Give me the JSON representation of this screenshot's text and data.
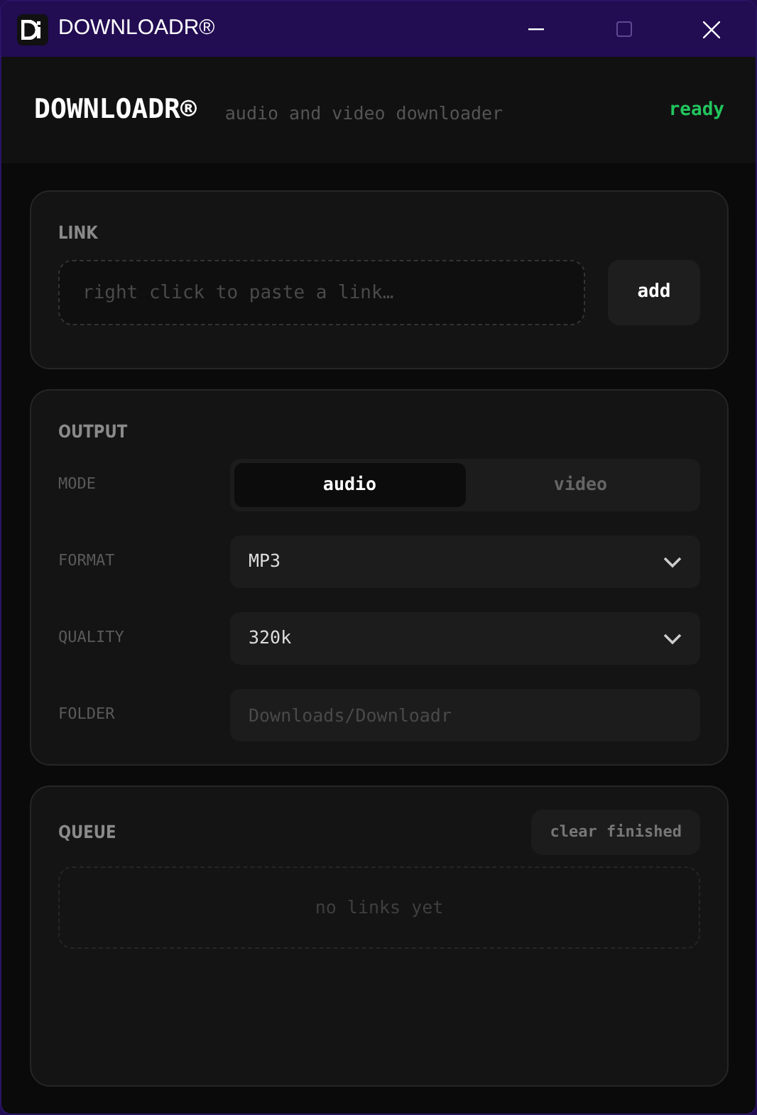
{
  "window": {
    "title": "DOWNLOADR®"
  },
  "header": {
    "logo": "DOWNLOADR®",
    "tagline": "audio and video downloader",
    "status": "ready"
  },
  "link": {
    "heading": "LINK",
    "placeholder": "right click to paste a link…",
    "button": "add"
  },
  "output": {
    "heading": "OUTPUT",
    "rows": [
      {
        "kind": "toggle",
        "label": "MODE",
        "options": [
          {
            "label": "audio",
            "selected": true
          },
          {
            "label": "video",
            "selected": false
          }
        ]
      },
      {
        "kind": "select",
        "label": "FORMAT",
        "value": "MP3"
      },
      {
        "kind": "select",
        "label": "QUALITY",
        "value": "320k"
      },
      {
        "kind": "input",
        "label": "FOLDER",
        "placeholder": "Downloads/Downloadr"
      }
    ]
  },
  "queue": {
    "heading": "QUEUE",
    "button": "clear finished",
    "empty": "no links yet"
  }
}
